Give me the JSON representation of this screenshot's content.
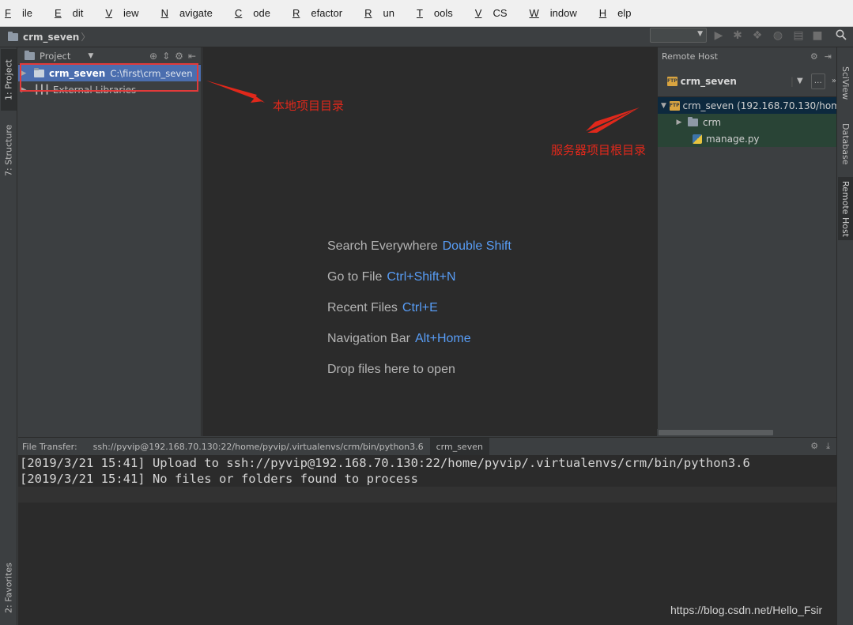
{
  "menu": [
    {
      "mn": "F",
      "rest": "ile"
    },
    {
      "mn": "E",
      "rest": "dit"
    },
    {
      "mn": "V",
      "rest": "iew"
    },
    {
      "mn": "N",
      "rest": "avigate"
    },
    {
      "mn": "C",
      "rest": "ode"
    },
    {
      "mn": "R",
      "rest": "efactor"
    },
    {
      "mn": "R",
      "rest": "un"
    },
    {
      "mn": "T",
      "rest": "ools"
    },
    {
      "mn": "V",
      "rest": "CS"
    },
    {
      "mn": "W",
      "rest": "indow"
    },
    {
      "mn": "H",
      "rest": "elp"
    }
  ],
  "navbar": {
    "project": "crm_seven",
    "sep": "〉"
  },
  "left_tabs": {
    "project": "1: Project",
    "structure": "7: Structure",
    "favorites": "2: Favorites"
  },
  "project_panel": {
    "title": "Project",
    "root_name": "crm_seven",
    "root_path": "C:\\first\\crm_seven",
    "external": "External Libraries"
  },
  "annotations": {
    "local": "本地项目目录",
    "server": "服务器项目根目录"
  },
  "hints": [
    {
      "text": "Search Everywhere",
      "key": "Double Shift"
    },
    {
      "text": "Go to File",
      "key": "Ctrl+Shift+N"
    },
    {
      "text": "Recent Files",
      "key": "Ctrl+E"
    },
    {
      "text": "Navigation Bar",
      "key": "Alt+Home"
    },
    {
      "text": "Drop files here to open",
      "key": ""
    }
  ],
  "remote": {
    "title": "Remote Host",
    "server_name": "crm_seven",
    "root": "crm_seven (192.168.70.130/hom",
    "children": [
      "crm",
      "manage.py"
    ]
  },
  "right_tabs": {
    "sciview": "SciView",
    "database": "Database",
    "remote": "Remote Host"
  },
  "bottom": {
    "label": "File Transfer:",
    "tabs": [
      "ssh://pyvip@192.168.70.130:22/home/pyvip/.virtualenvs/crm/bin/python3.6",
      "crm_seven"
    ]
  },
  "console_lines": [
    "[2019/3/21 15:41] Upload to ssh://pyvip@192.168.70.130:22/home/pyvip/.virtualenvs/crm/bin/python3.6",
    "[2019/3/21 15:41] No files or folders found to process"
  ],
  "watermark": "https://blog.csdn.net/Hello_Fsir",
  "colors": {
    "accent": "#589df6",
    "selection": "#4b6eaf",
    "annotation": "#e0281b",
    "highlight_box": "#e23a3a"
  }
}
